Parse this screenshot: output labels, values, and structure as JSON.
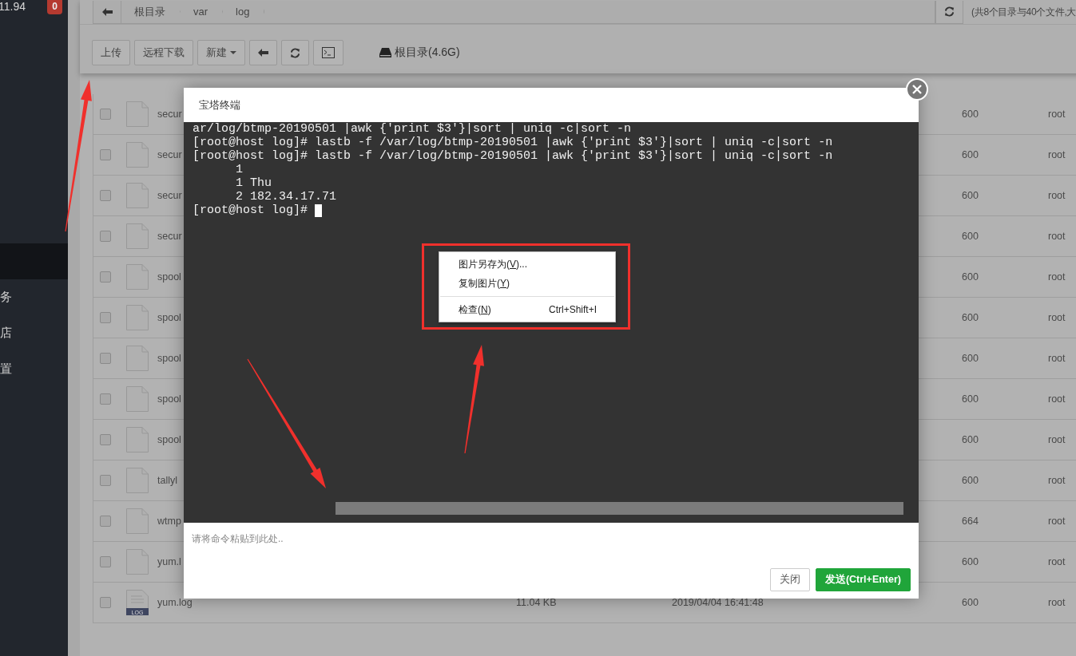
{
  "sidebar": {
    "header": "11.94",
    "badge": "0",
    "items": [
      {
        "selected": true
      },
      {
        "label": "务",
        "selected": false
      },
      {
        "label": "店",
        "selected": false
      },
      {
        "label": "置",
        "selected": false
      }
    ]
  },
  "breadcrumb": [
    "根目录",
    "var",
    "log"
  ],
  "summary": "(共8个目录与40个文件,大",
  "toolbar": {
    "buttons": [
      {
        "kind": "text",
        "label": "上传"
      },
      {
        "kind": "text",
        "label": "远程下载"
      },
      {
        "kind": "dropdown",
        "label": "新建"
      },
      {
        "kind": "back"
      },
      {
        "kind": "refresh"
      },
      {
        "kind": "terminal"
      }
    ],
    "disk": "根目录(4.6G)"
  },
  "files": [
    {
      "name": "secur",
      "permission": "600",
      "owner": "root",
      "kind": "plain",
      "checked": false
    },
    {
      "name": "secur",
      "permission": "600",
      "owner": "root",
      "kind": "plain",
      "checked": false
    },
    {
      "name": "secur",
      "permission": "600",
      "owner": "root",
      "kind": "plain",
      "checked": false
    },
    {
      "name": "secur",
      "permission": "600",
      "owner": "root",
      "kind": "plain",
      "checked": false
    },
    {
      "name": "spool",
      "permission": "600",
      "owner": "root",
      "kind": "plain",
      "checked": false
    },
    {
      "name": "spool",
      "permission": "600",
      "owner": "root",
      "kind": "plain",
      "checked": false
    },
    {
      "name": "spool",
      "permission": "600",
      "owner": "root",
      "kind": "plain",
      "checked": false
    },
    {
      "name": "spool",
      "permission": "600",
      "owner": "root",
      "kind": "plain",
      "checked": false
    },
    {
      "name": "spool",
      "permission": "600",
      "owner": "root",
      "kind": "plain",
      "checked": false
    },
    {
      "name": "tallyl",
      "permission": "600",
      "owner": "root",
      "kind": "plain",
      "checked": false
    },
    {
      "name": "wtmp",
      "permission": "664",
      "owner": "root",
      "kind": "plain",
      "checked": false
    },
    {
      "name": "yum.l",
      "permission": "600",
      "owner": "root",
      "kind": "plain",
      "checked": false
    },
    {
      "name": "yum.log",
      "size": "11.04 KB",
      "modified": "2019/04/04 16:41:48",
      "permission": "600",
      "owner": "root",
      "kind": "log",
      "badge": "LOG",
      "checked": false
    }
  ],
  "terminal_dialog": {
    "title": "宝塔终端",
    "lines": [
      {
        "text": "ar/log/btmp-20190501 |awk {'print $3'}|sort | uniq -c|sort -n",
        "cursor": false
      },
      {
        "text": "[root@host log]# lastb -f /var/log/btmp-20190501 |awk {'print $3'}|sort | uniq -c|sort -n",
        "cursor": false
      },
      {
        "text": "[root@host log]# lastb -f /var/log/btmp-20190501 |awk {'print $3'}|sort | uniq -c|sort -n",
        "cursor": false
      },
      {
        "text": "      1",
        "cursor": false
      },
      {
        "text": "      1 Thu",
        "cursor": false
      },
      {
        "text": "      2 182.34.17.71",
        "cursor": false
      },
      {
        "text": "[root@host log]#",
        "cursor": true
      }
    ],
    "input": {
      "placeholder": "请将命令粘贴到此处.."
    },
    "buttons": [
      {
        "label": "关闭",
        "kind": "default"
      },
      {
        "label": "发送(Ctrl+Enter)",
        "kind": "primary"
      }
    ]
  },
  "context_menu": [
    {
      "kind": "item",
      "label": "图片另存为(",
      "key": "V",
      "suffix": ")..."
    },
    {
      "kind": "item",
      "label": "复制图片(",
      "key": "Y",
      "suffix": ")"
    },
    {
      "kind": "separator"
    },
    {
      "kind": "item",
      "label": "检查(",
      "key": "N",
      "suffix": ")",
      "shortcut": "Ctrl+Shift+I"
    }
  ]
}
